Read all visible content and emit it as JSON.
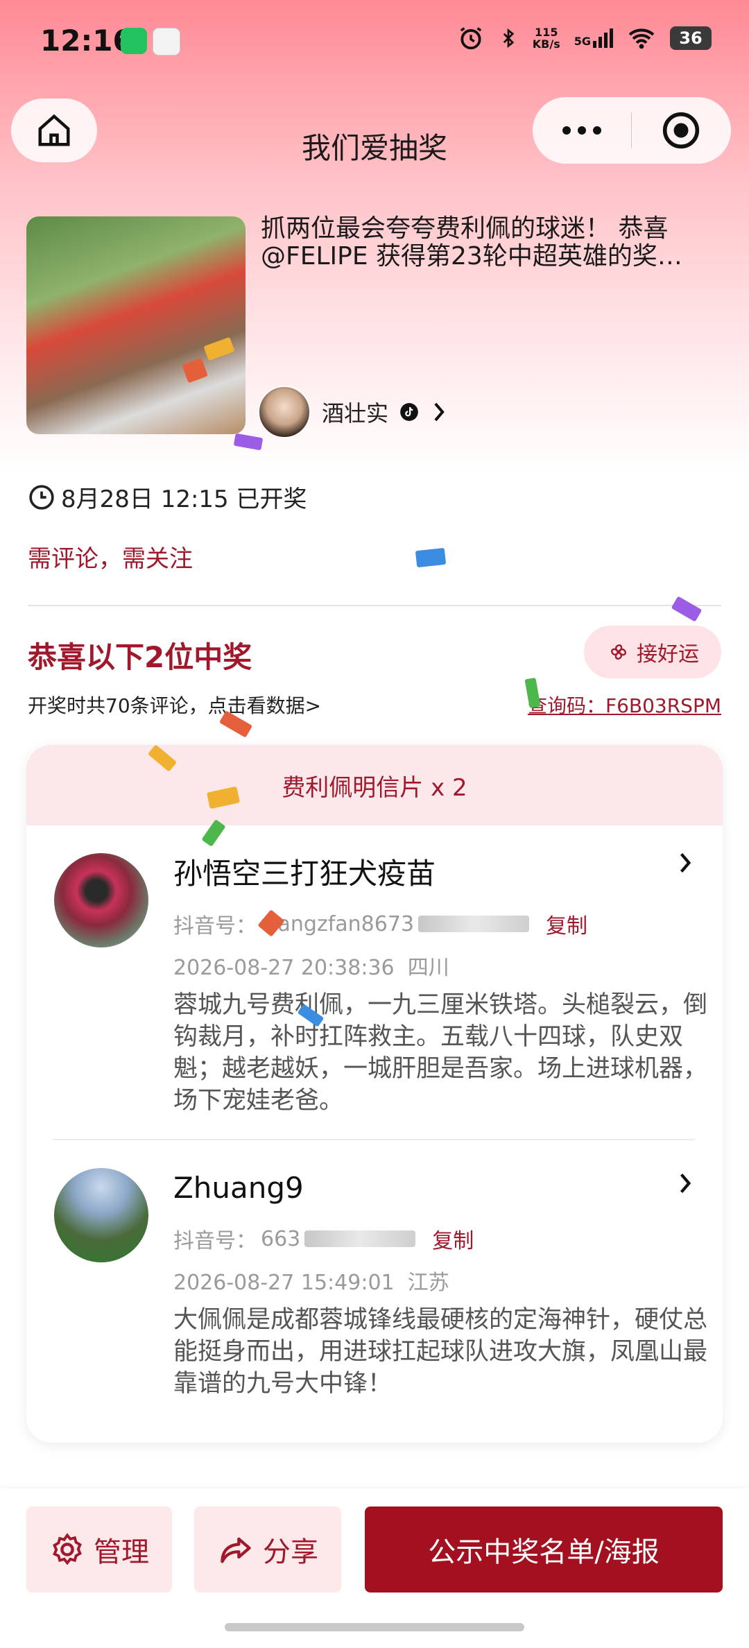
{
  "status_bar": {
    "time": "12:16",
    "net_speed_value": "115",
    "net_speed_unit": "KB/s",
    "signal": "5G",
    "battery": "36"
  },
  "nav": {
    "title": "我们爱抽奖"
  },
  "prize": {
    "title": "抓两位最会夸夸费利佩的球迷！ 恭喜@FELIPE 获得第23轮中超英雄的奖…",
    "author": "酒壮实"
  },
  "draw": {
    "time_text": "8月28日 12:15 已开奖",
    "conditions": "需评论，需关注"
  },
  "results": {
    "heading": "恭喜以下2位中奖",
    "luck_button": "接好运",
    "comments_info": "开奖时共70条评论，点击看数据>",
    "check_code": "查询码：F6B03RSPM"
  },
  "card": {
    "header": "费利佩明信片 x 2",
    "winners": [
      {
        "name": "孙悟空三打狂犬疫苗",
        "id_label": "抖音号：",
        "id_visible": "wangzfan8673",
        "copy": "复制",
        "time": "2026-08-27 20:38:36",
        "region": "四川",
        "comment": "蓉城九号费利佩，一九三厘米铁塔。头槌裂云，倒钩裁月，补时扛阵救主。五载八十四球，队史双魁；越老越妖，一城肝胆是吾家。场上进球机器，场下宠娃老爸。"
      },
      {
        "name": "Zhuang9",
        "id_label": "抖音号：",
        "id_visible": "663",
        "copy": "复制",
        "time": "2026-08-27 15:49:01",
        "region": "江苏",
        "comment": "大佩佩是成都蓉城锋线最硬核的定海神针，硬仗总能挺身而出，用进球扛起球队进攻大旗，凤凰山最靠谱的九号大中锋！"
      }
    ]
  },
  "bottom": {
    "manage": "管理",
    "share": "分享",
    "publish": "公示中奖名单/海报"
  },
  "colors": {
    "accent": "#a3101f",
    "accent_light": "#fde8ea",
    "header_gradient_top": "#ff8a95"
  }
}
